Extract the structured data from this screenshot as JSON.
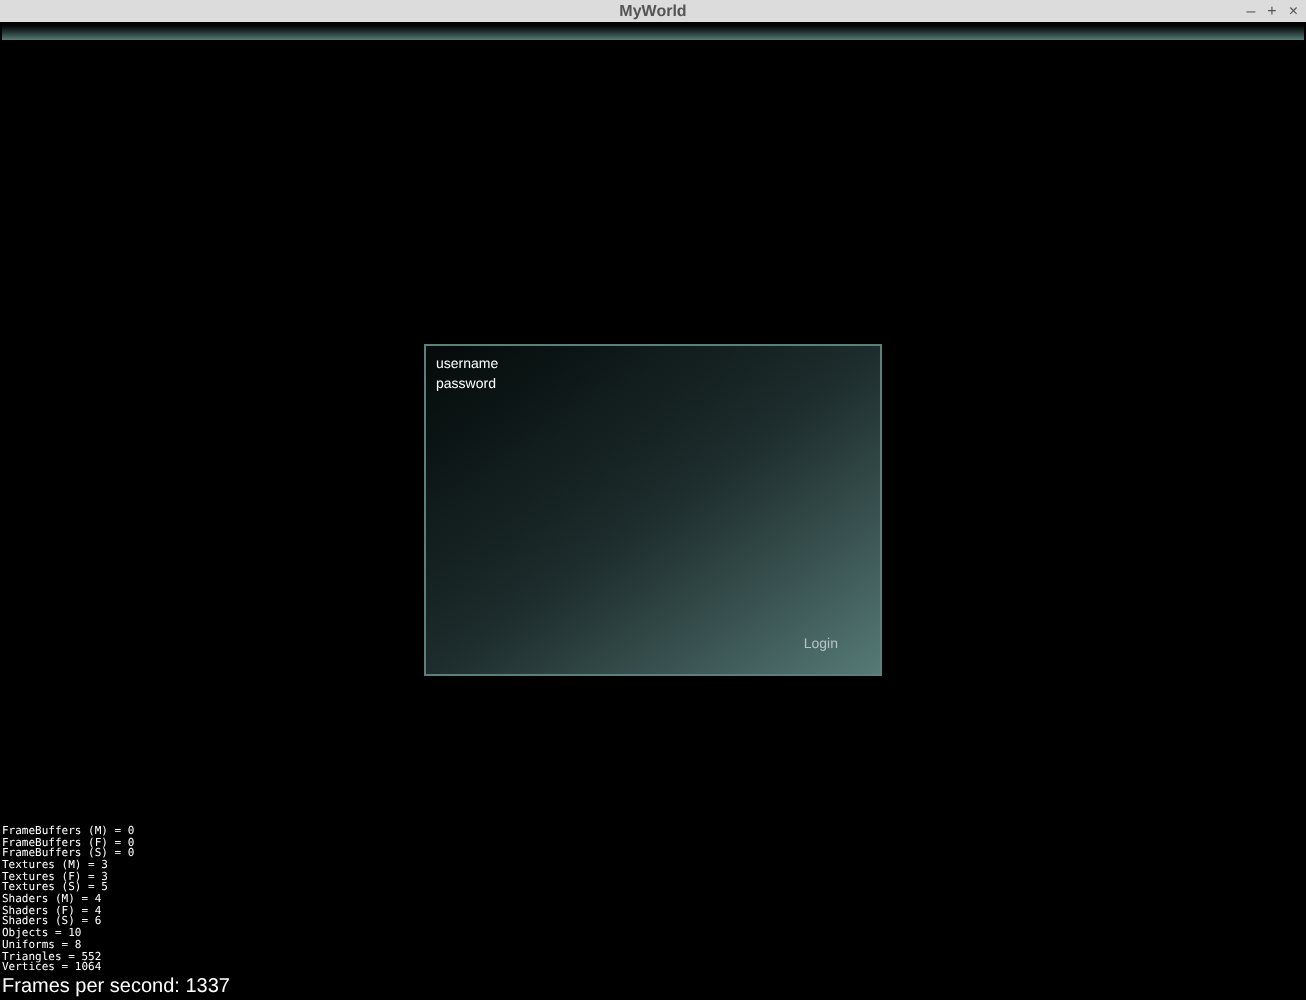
{
  "window": {
    "title": "MyWorld",
    "controls": [
      "–",
      "+",
      "×"
    ]
  },
  "login_panel": {
    "fields": [
      {
        "placeholder": "username"
      },
      {
        "placeholder": "password"
      }
    ],
    "button": "Login"
  },
  "stats": [
    "FrameBuffers (M) = 0",
    "FrameBuffers (F) = 0",
    "FrameBuffers (S) = 0",
    "Textures (M) = 3",
    "Textures (F) = 3",
    "Textures (S) = 5",
    "Shaders (M) = 4",
    "Shaders (F) = 4",
    "Shaders (S) = 6",
    "Objects = 10",
    "Uniforms = 8",
    "Triangles = 552",
    "Vertices = 1064"
  ],
  "fps": "Frames per second: 1337"
}
